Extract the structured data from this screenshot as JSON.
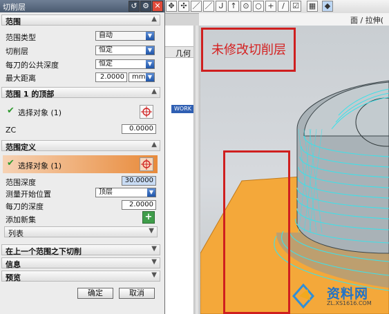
{
  "dialog": {
    "title": "切削层",
    "range_section": {
      "header": "范围",
      "range_type": {
        "label": "范围类型",
        "value": "自动"
      },
      "cut_level": {
        "label": "切削层",
        "value": "恒定"
      },
      "common_depth": {
        "label": "每刀的公共深度",
        "value": "恒定"
      },
      "max_distance": {
        "label": "最大距离",
        "value": "2.0000",
        "unit": "mm"
      }
    },
    "range1_top": {
      "header": "范围 1 的顶部",
      "select_label": "选择对象 (1)",
      "zc_label": "ZC",
      "zc_value": "0.0000"
    },
    "range_definition": {
      "header": "范围定义",
      "select_label": "选择对象 (1)",
      "range_depth": {
        "label": "范围深度",
        "value": "30.0000"
      },
      "measure_from": {
        "label": "测量开始位置",
        "value": "顶层"
      },
      "per_cut_depth": {
        "label": "每刀的深度",
        "value": "2.0000"
      },
      "add_set_label": "添加新集",
      "list_label": "列表"
    },
    "collapsed_sections": {
      "below_last": "在上一个范围之下切削",
      "info": "信息",
      "preview": "预览"
    },
    "buttons": {
      "ok": "确定",
      "cancel": "取消"
    }
  },
  "background": {
    "breadcrumb": "面 / 拉伸(",
    "nav_column_header": "几何",
    "nav_selected_item": "WORK",
    "annotation": "未修改切削层"
  },
  "watermark": {
    "title": "资料网",
    "url": "ZL.XS1616.COM"
  },
  "colors": {
    "annotation_red": "#d42020",
    "highlight_orange": "#e88a3a",
    "surface_orange": "#f4a83a",
    "cyan_toolpath": "#3fe0e8",
    "accent_blue": "#2f5fb3"
  },
  "icons": [
    "reset-icon",
    "gear-icon",
    "close-icon",
    "crosshair-icon",
    "check-icon",
    "add-set-icon",
    "chevron-up-icon",
    "chevron-down-icon"
  ]
}
